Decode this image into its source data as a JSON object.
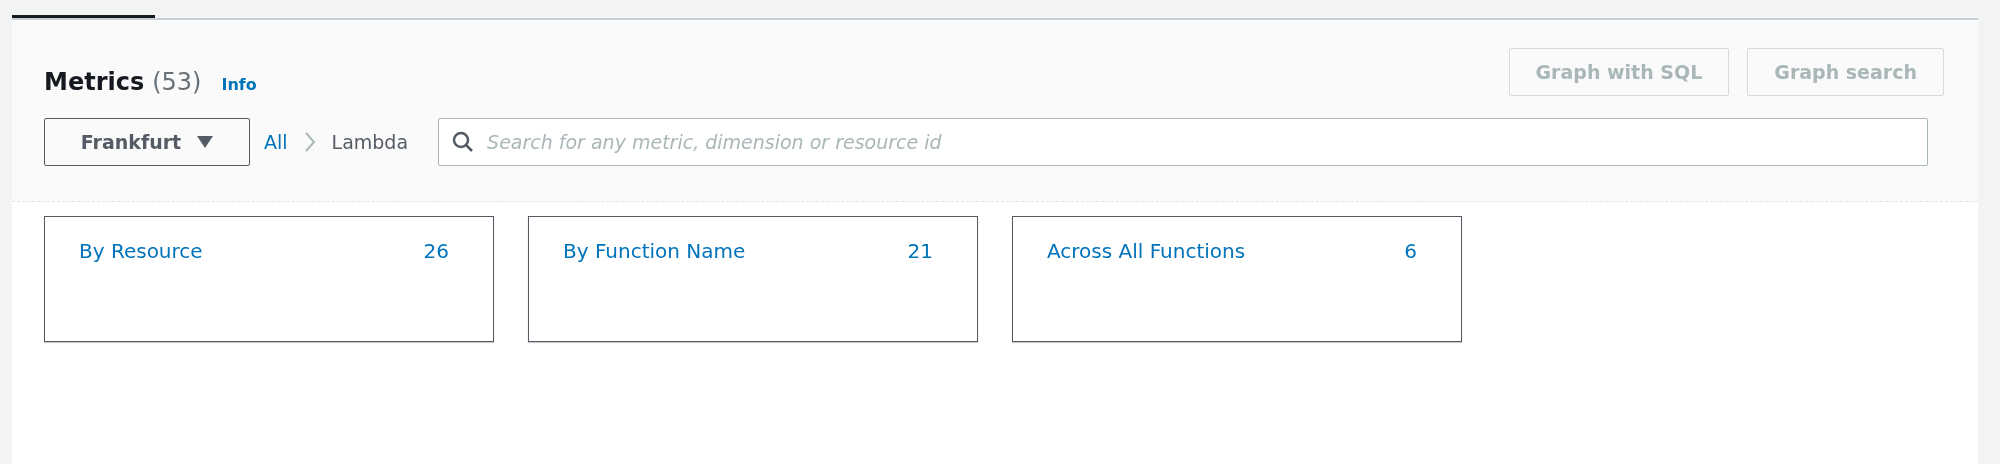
{
  "tabs": [
    {
      "selected": true
    }
  ],
  "header": {
    "title": "Metrics",
    "count": "(53)",
    "info_link": "Info"
  },
  "buttons": [
    {
      "label": "Graph with SQL",
      "disabled": true
    },
    {
      "label": "Graph search",
      "disabled": true
    }
  ],
  "region_dropdown": {
    "value": "Frankfurt"
  },
  "breadcrumb": [
    {
      "label": "All",
      "kind": "link"
    },
    {
      "label": "Lambda",
      "kind": "current"
    }
  ],
  "search": {
    "placeholder": "Search for any metric, dimension or resource id"
  },
  "cards": [
    {
      "title": "By Resource",
      "count": "26"
    },
    {
      "title": "By Function Name",
      "count": "21"
    },
    {
      "title": "Across All Functions",
      "count": "6"
    }
  ]
}
